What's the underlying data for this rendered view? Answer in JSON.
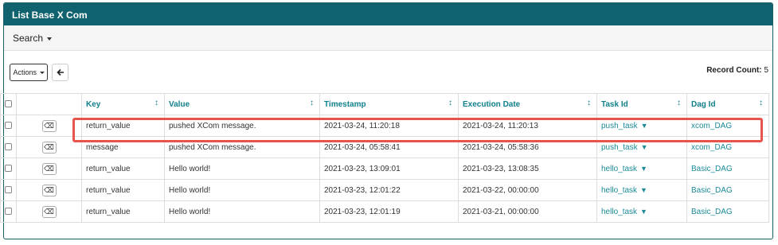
{
  "header": {
    "title": "List Base X Com"
  },
  "search": {
    "label": "Search"
  },
  "toolbar": {
    "actions_label": "Actions",
    "back_icon": "arrow-left-icon"
  },
  "record_count": {
    "label": "Record Count:",
    "value": "5"
  },
  "table": {
    "columns": [
      "Key",
      "Value",
      "Timestamp",
      "Execution Date",
      "Task Id",
      "Dag Id"
    ],
    "rows": [
      {
        "key": "return_value",
        "value": "pushed XCom message.",
        "timestamp": "2021-03-24, 11:20:18",
        "execution_date": "2021-03-24, 11:20:13",
        "task_id": "push_task",
        "dag_id": "xcom_DAG"
      },
      {
        "key": "message",
        "value": "pushed XCom message.",
        "timestamp": "2021-03-24, 05:58:41",
        "execution_date": "2021-03-24, 05:58:36",
        "task_id": "push_task",
        "dag_id": "xcom_DAG"
      },
      {
        "key": "return_value",
        "value": "Hello world!",
        "timestamp": "2021-03-23, 13:09:01",
        "execution_date": "2021-03-23, 13:08:35",
        "task_id": "hello_task",
        "dag_id": "Basic_DAG"
      },
      {
        "key": "return_value",
        "value": "Hello world!",
        "timestamp": "2021-03-23, 12:01:22",
        "execution_date": "2021-03-22, 00:00:00",
        "task_id": "hello_task",
        "dag_id": "Basic_DAG"
      },
      {
        "key": "return_value",
        "value": "Hello world!",
        "timestamp": "2021-03-23, 12:01:19",
        "execution_date": "2021-03-21, 00:00:00",
        "task_id": "hello_task",
        "dag_id": "Basic_DAG"
      }
    ]
  },
  "colors": {
    "header_bg": "#10626e",
    "link": "#1a8a98",
    "highlight": "#e8544c"
  }
}
